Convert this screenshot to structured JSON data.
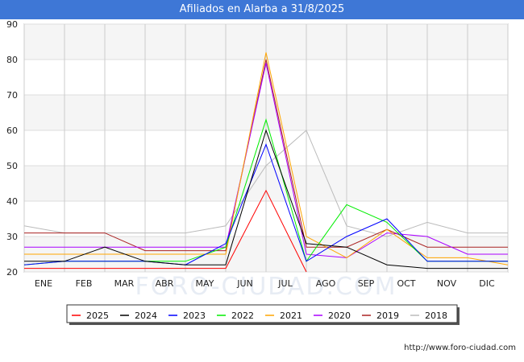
{
  "header": {
    "title": "Afiliados en Alarba a 31/8/2025"
  },
  "footer": {
    "url": "http://www.foro-ciudad.com"
  },
  "watermark": {
    "text": "FORO-CIUDAD.COM"
  },
  "chart_data": {
    "type": "line",
    "title": "Afiliados en Alarba a 31/8/2025",
    "xlabel": "",
    "ylabel": "",
    "categories": [
      "",
      "ENE",
      "FEB",
      "MAR",
      "ABR",
      "MAY",
      "JUN",
      "JUL",
      "AGO",
      "SEP",
      "OCT",
      "NOV",
      "DIC"
    ],
    "ylim": [
      20,
      90
    ],
    "yticks": [
      20,
      30,
      40,
      50,
      60,
      70,
      80,
      90
    ],
    "grid": true,
    "legend_position": "bottom",
    "series": [
      {
        "name": "2025",
        "color": "#ff0000",
        "values": [
          21,
          21,
          21,
          21,
          21,
          21,
          43,
          20,
          null,
          null,
          null,
          null,
          null
        ]
      },
      {
        "name": "2024",
        "color": "#000000",
        "values": [
          23,
          23,
          27,
          23,
          22,
          22,
          60,
          28,
          27,
          22,
          21,
          21,
          21
        ]
      },
      {
        "name": "2023",
        "color": "#0000ff",
        "values": [
          22,
          23,
          23,
          23,
          22,
          28,
          56,
          23,
          30,
          35,
          23,
          23,
          23
        ]
      },
      {
        "name": "2022",
        "color": "#00ee00",
        "values": [
          22,
          23,
          23,
          23,
          23,
          27,
          63,
          23,
          39,
          34,
          23,
          23,
          23
        ]
      },
      {
        "name": "2021",
        "color": "#ffa500",
        "values": [
          25,
          25,
          25,
          25,
          25,
          25,
          82,
          30,
          24,
          32,
          24,
          24,
          22
        ]
      },
      {
        "name": "2020",
        "color": "#aa00ff",
        "values": [
          27,
          27,
          27,
          27,
          27,
          27,
          79,
          25,
          24,
          31,
          30,
          25,
          25
        ]
      },
      {
        "name": "2019",
        "color": "#aa2222",
        "values": [
          31,
          31,
          31,
          26,
          26,
          26,
          80,
          27,
          27,
          32,
          27,
          27,
          27
        ]
      },
      {
        "name": "2018",
        "color": "#bbbbbb",
        "values": [
          33,
          31,
          31,
          31,
          31,
          33,
          50,
          60,
          33,
          30,
          34,
          31,
          31
        ]
      }
    ]
  }
}
